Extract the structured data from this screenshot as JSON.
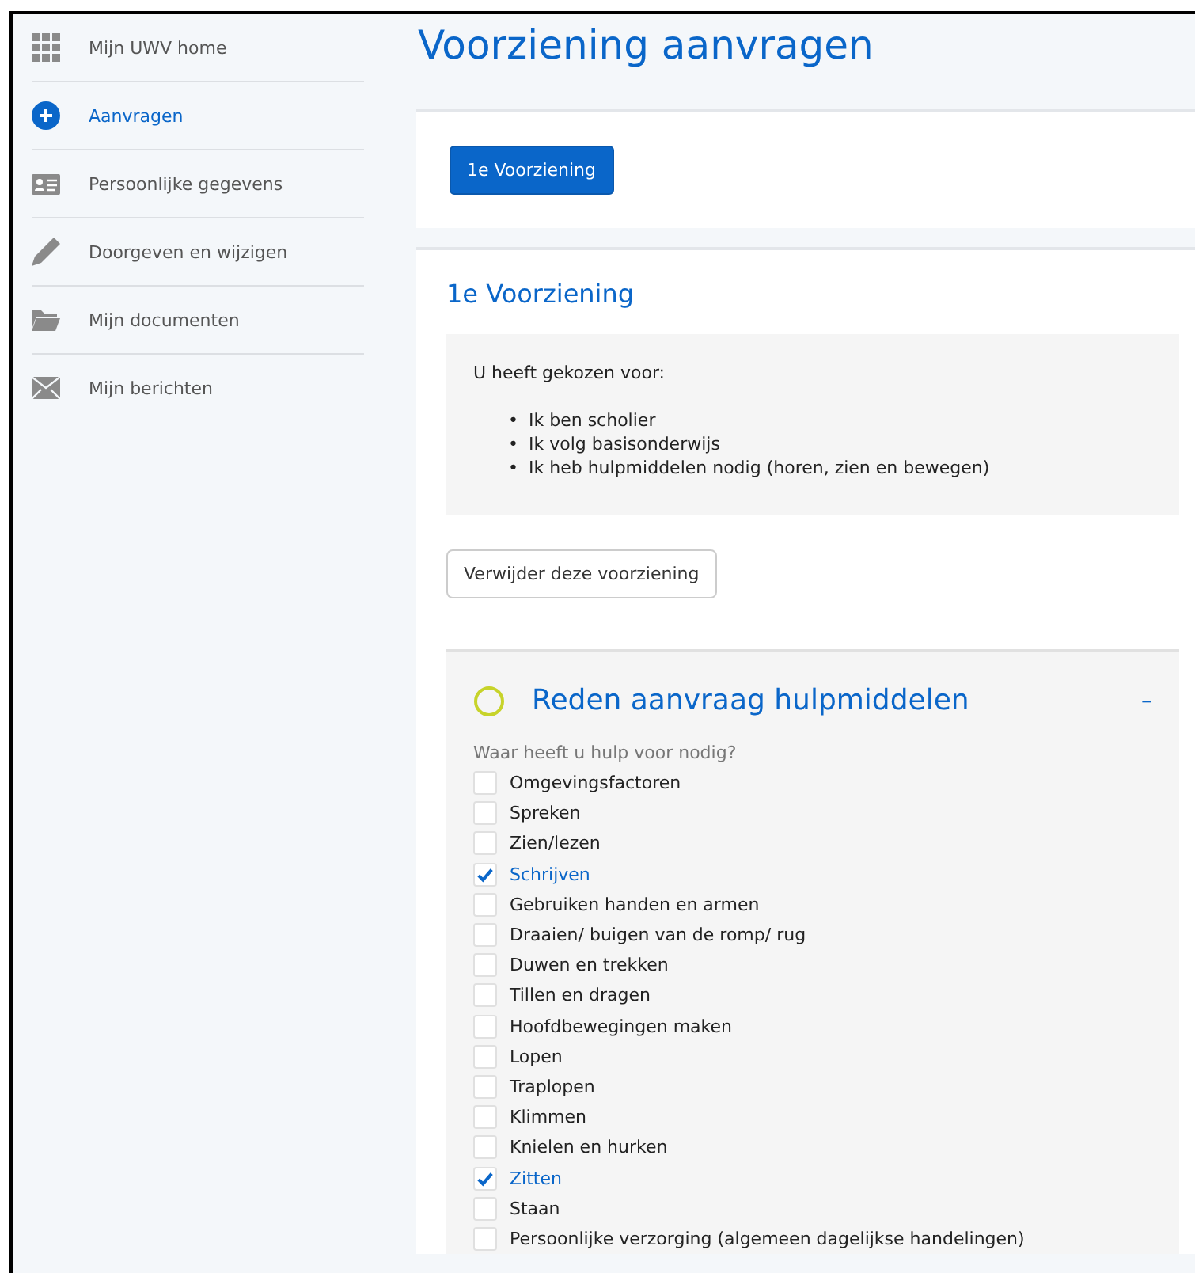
{
  "sidebar": {
    "items": [
      {
        "label": "Mijn UWV home",
        "selected": false
      },
      {
        "label": "Aanvragen",
        "selected": true
      },
      {
        "label": "Persoonlijke gegevens",
        "selected": false
      },
      {
        "label": "Doorgeven en wijzigen",
        "selected": false
      },
      {
        "label": "Mijn documenten",
        "selected": false
      },
      {
        "label": "Mijn berichten",
        "selected": false
      }
    ]
  },
  "page_title": "Voorziening aanvragen",
  "tabs": [
    {
      "label": "1e Voorziening",
      "selected": true
    }
  ],
  "provision": {
    "title": "1e Voorziening",
    "summary": {
      "intro": "U heeft gekozen voor:",
      "items": [
        {
          "bullet": "•",
          "text": "Ik ben scholier"
        },
        {
          "bullet": "•",
          "text": "Ik volg basisonderwijs"
        },
        {
          "bullet": "•",
          "text": "Ik heb hulpmiddelen nodig (horen, zien en bewegen)"
        }
      ]
    },
    "remove_button": "Verwijder deze voorziening",
    "section": {
      "title": "Reden aanvraag hulpmiddelen",
      "collapse_icon": "–",
      "question": "Waar heeft u hulp voor nodig?",
      "options": [
        {
          "label": "Omgevingsfactoren",
          "checked": false
        },
        {
          "label": "Spreken",
          "checked": false
        },
        {
          "label": "Zien/lezen",
          "checked": false
        },
        {
          "label": "Schrijven",
          "checked": true
        },
        {
          "label": "Gebruiken handen en armen",
          "checked": false
        },
        {
          "label": "Draaien/ buigen van de romp/ rug",
          "checked": false
        },
        {
          "label": "Duwen en trekken",
          "checked": false
        },
        {
          "label": "Tillen en dragen",
          "checked": false
        },
        {
          "label": "Hoofdbewegingen maken",
          "checked": false
        },
        {
          "label": "Lopen",
          "checked": false
        },
        {
          "label": "Traplopen",
          "checked": false
        },
        {
          "label": "Klimmen",
          "checked": false
        },
        {
          "label": "Knielen en hurken",
          "checked": false
        },
        {
          "label": "Zitten",
          "checked": true
        },
        {
          "label": "Staan",
          "checked": false
        },
        {
          "label": "Persoonlijke verzorging (algemeen dagelijkse handelingen)",
          "checked": false
        }
      ]
    }
  }
}
